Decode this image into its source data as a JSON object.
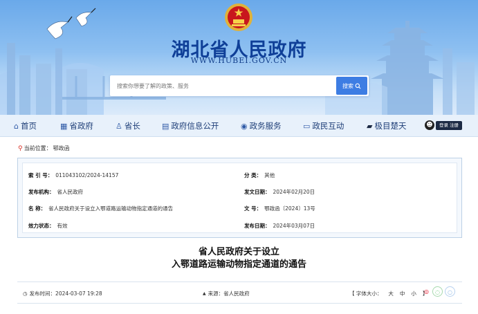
{
  "header": {
    "site_title": "湖北省人民政府",
    "site_url": "WWW.HUBEI.GOV.CN",
    "search": {
      "placeholder": "搜索你想要了解的政策、服务",
      "button_label": "搜索"
    }
  },
  "nav": {
    "items": [
      {
        "label": "首页",
        "icon": "home-icon"
      },
      {
        "label": "省政府",
        "icon": "building-icon"
      },
      {
        "label": "省长",
        "icon": "person-icon"
      },
      {
        "label": "政府信息公开",
        "icon": "document-icon"
      },
      {
        "label": "政务服务",
        "icon": "service-icon"
      },
      {
        "label": "政民互动",
        "icon": "chat-icon"
      },
      {
        "label": "极目楚天",
        "icon": "car-icon"
      }
    ],
    "login_label": "登录 注册"
  },
  "breadcrumb": {
    "prefix": "当前位置：",
    "current": "鄂政函"
  },
  "info": {
    "index_no": {
      "label": "索 引 号：",
      "value": "011043102/2024-14157"
    },
    "category": {
      "label": "分 类：",
      "value": "其他"
    },
    "issuer": {
      "label": "发布机构：",
      "value": "省人民政府"
    },
    "issue_date": {
      "label": "发文日期：",
      "value": "2024年02月20日"
    },
    "name": {
      "label": "名 称：",
      "value": "省人民政府关于设立入鄂道路运输动物指定通道的通告"
    },
    "doc_no": {
      "label": "文 号：",
      "value": "鄂政函〔2024〕13号"
    },
    "validity": {
      "label": "效力状态：",
      "value": "有效"
    },
    "publish_date": {
      "label": "发布日期：",
      "value": "2024年03月07日"
    }
  },
  "article": {
    "title_line1": "省人民政府关于设立",
    "title_line2": "入鄂道路运输动物指定通道的通告"
  },
  "meta": {
    "publish_time": "发布时间：2024-03-07 19:28",
    "source": "来源：省人民政府",
    "font_size_label": "【 字体大小：",
    "font_large": "大",
    "font_medium": "中",
    "font_small": "小",
    "font_close": "】"
  },
  "colors": {
    "title_blue": "#0f3f98",
    "search_button": "#3d7de3",
    "nav_bg": "#e8f1fb"
  }
}
